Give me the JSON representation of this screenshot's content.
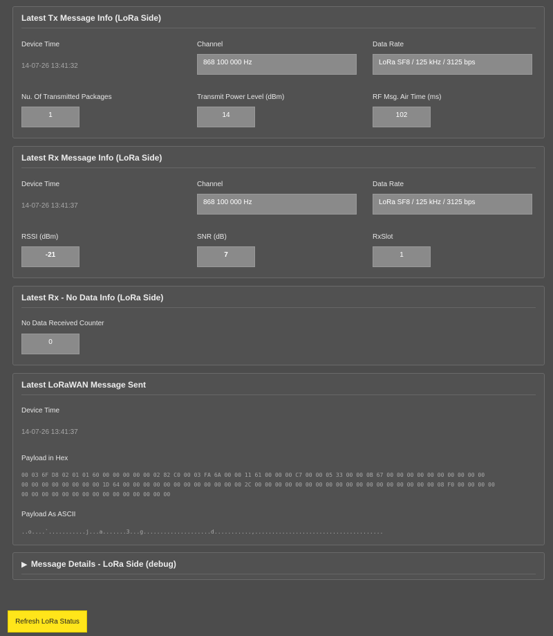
{
  "tx": {
    "title": "Latest Tx Message Info (LoRa Side)",
    "device_time_label": "Device Time",
    "device_time": "14-07-26 13:41:32",
    "channel_label": "Channel",
    "channel": "868 100 000 Hz",
    "data_rate_label": "Data Rate",
    "data_rate": "LoRa SF8 / 125 kHz / 3125 bps",
    "packages_label": "Nu. Of Transmitted Packages",
    "packages": "1",
    "power_label": "Transmit Power Level (dBm)",
    "power": "14",
    "airtime_label": "RF Msg. Air Time (ms)",
    "airtime": "102"
  },
  "rx": {
    "title": "Latest Rx Message Info (LoRa Side)",
    "device_time_label": "Device Time",
    "device_time": "14-07-26 13:41:37",
    "channel_label": "Channel",
    "channel": "868 100 000 Hz",
    "data_rate_label": "Data Rate",
    "data_rate": "LoRa SF8 / 125 kHz / 3125 bps",
    "rssi_label": "RSSI (dBm)",
    "rssi": "-21",
    "snr_label": "SNR (dB)",
    "snr": "7",
    "rxslot_label": "RxSlot",
    "rxslot": "1"
  },
  "nodata": {
    "title": "Latest Rx - No Data Info (LoRa Side)",
    "counter_label": "No Data Received Counter",
    "counter": "0"
  },
  "lorawan": {
    "title": "Latest LoRaWAN Message Sent",
    "device_time_label": "Device Time",
    "device_time": "14-07-26 13:41:37",
    "hex_label": "Payload in Hex",
    "hex_line1": "00 03 6F D8 02 01 01 60 00 00 00 00 00 02 82 C0 00 03 FA 6A 00 00 11 61 00 00 00 C7 00 00 05 33 00 00 0B 67 00 00 00 00 00 00 00 00 00 00",
    "hex_line2": "00 00 00 00 00 00 00 00 1D 64 00 00 00 00 00 00 00 00 00 00 00 00 2C 00 00 00 00 00 00 00 00 00 00 00 00 00 00 00 00 00 00 08 F0 00 00 00 00",
    "hex_line3": "00 00 00 00 00 00 00 00 00 00 00 00 00 00 00",
    "ascii_label": "Payload As ASCII",
    "ascii": "..o....`...........j...a.......3...g....................d...........,......................................"
  },
  "debug": {
    "title": "Message Details - LoRa Side (debug)"
  },
  "refresh_label": "Refresh LoRa Status",
  "colors": {
    "background": "#4c4c4c",
    "panel": "#515151",
    "field": "#8a8a8a",
    "button": "#ffe51a"
  }
}
